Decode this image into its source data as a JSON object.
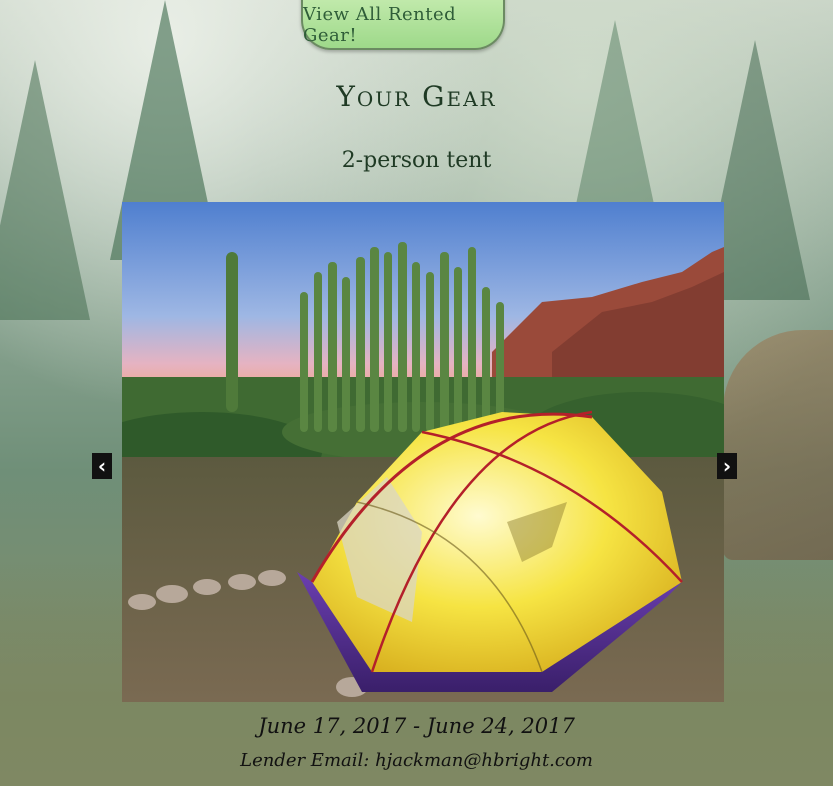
{
  "header": {
    "view_all_label": "View All Rented Gear!"
  },
  "page": {
    "title": "Your Gear"
  },
  "item": {
    "name": "2-person tent",
    "dates": "June 17, 2017 - June 24, 2017",
    "lender_label": "Lender Email:",
    "lender_email": "hjackman@hbright.com"
  },
  "carousel": {
    "prev_symbol": "‹",
    "next_symbol": "›"
  },
  "colors": {
    "button_green": "#9ed98a",
    "tent_yellow": "#f3e23a",
    "tent_purple": "#4a2a86"
  }
}
